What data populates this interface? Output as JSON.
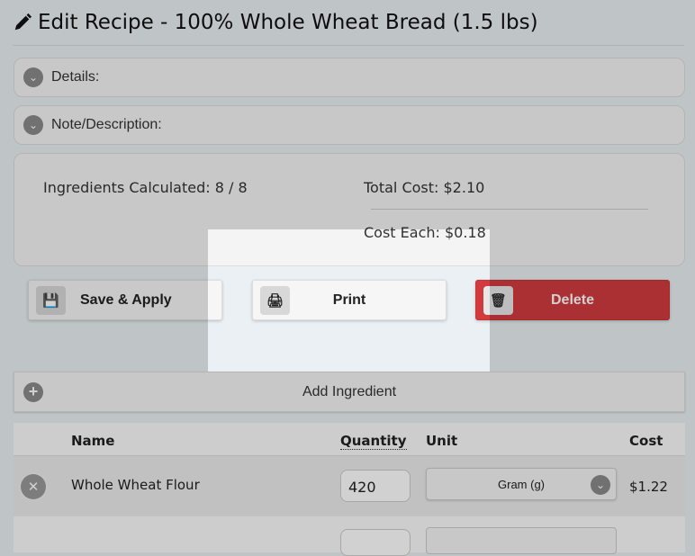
{
  "header": {
    "title": "Edit Recipe - 100% Whole Wheat Bread (1.5 lbs)",
    "icon": "pencil-icon"
  },
  "panels": {
    "details": "Details:",
    "note": "Note/Description:"
  },
  "summary": {
    "ingredients_calculated": "Ingredients Calculated: 8 / 8",
    "total_cost": "Total Cost: $2.10",
    "cost_each": "Cost Each: $0.18"
  },
  "actions": {
    "save": "Save & Apply",
    "print": "Print",
    "delete": "Delete",
    "delete_color": "#d13b3f"
  },
  "add_ingredient": "Add Ingredient",
  "table": {
    "headers": {
      "name": "Name",
      "quantity": "Quantity",
      "unit": "Unit",
      "cost": "Cost"
    },
    "rows": [
      {
        "name": "Whole Wheat Flour",
        "quantity": "420",
        "unit": "Gram (g)",
        "cost": "$1.22"
      }
    ]
  }
}
